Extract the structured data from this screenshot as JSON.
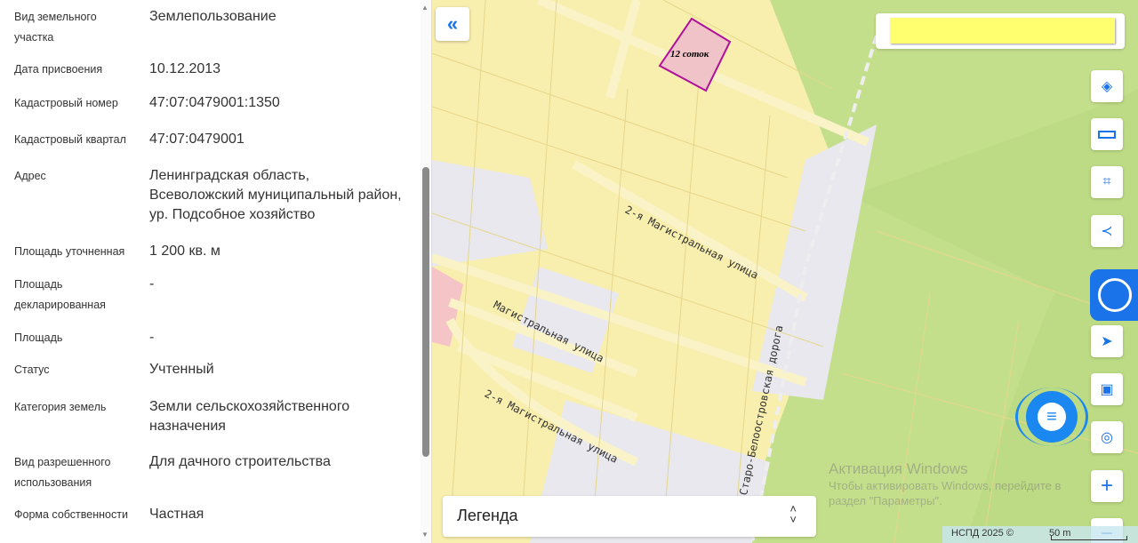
{
  "details": [
    {
      "label": "Вид земельного участка",
      "value": "Землепользование"
    },
    {
      "label": "Дата присвоения",
      "value": "10.12.2013"
    },
    {
      "label": "Кадастровый номер",
      "value": "47:07:0479001:1350"
    },
    {
      "label": "Кадастровый квартал",
      "value": "47:07:0479001"
    },
    {
      "label": "Адрес",
      "value": "Ленинградская область, Всеволожский муниципальный район, ур. Подсобное хозяйство"
    },
    {
      "label": "Площадь уточненная",
      "value": "1 200 кв. м"
    },
    {
      "label": "Площадь декларированная",
      "value": "-"
    },
    {
      "label": "Площадь",
      "value": "-"
    },
    {
      "label": "Статус",
      "value": "Учтенный"
    },
    {
      "label": "Категория земель",
      "value": "Земли сельскохозяйственного назначения"
    },
    {
      "label": "Вид разрешенного использования",
      "value": "Для дачного строительства"
    },
    {
      "label": "Форма собственности",
      "value": "Частная"
    }
  ],
  "map": {
    "parcel_label": "12 соток",
    "streets": [
      "2-я Магистральная улица",
      "Магистральная улица",
      "2-я Магистральная улица",
      "Старо-Белоостровская дорога"
    ],
    "legend_label": "Легенда",
    "footer": "НСПД 2025 ©",
    "scale": "50 m",
    "watermark_title": "Активация Windows",
    "watermark_sub": "Чтобы активировать Windows, перейдите в раздел \"Параметры\".",
    "colors": {
      "accent": "#1a73e8",
      "parcel_fill": "#efc3c8",
      "parcel_border": "#b0109a",
      "highlight": "#ffff70"
    }
  }
}
